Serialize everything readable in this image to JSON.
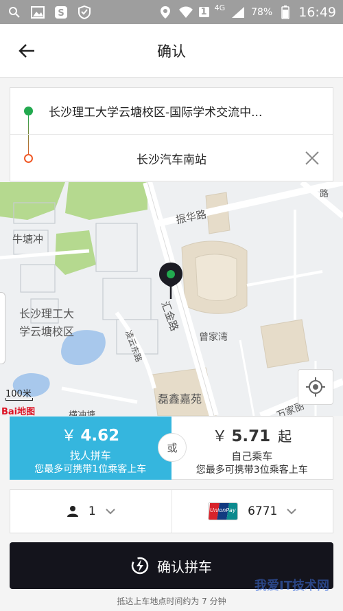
{
  "status_bar": {
    "network": "4G",
    "battery": "78%",
    "time": "16:49",
    "sim_slot": "1"
  },
  "header": {
    "title": "确认"
  },
  "route": {
    "start": "长沙理工大学云塘校区-国际学术交流中...",
    "end": "长沙汽车南站"
  },
  "map": {
    "labels": {
      "zhenhua_road": "振华路",
      "niutang": "牛塘冲",
      "campus_line1": "长沙理工大",
      "campus_line2": "学云塘校区",
      "huijin_road": "汇金路",
      "lingyun_road": "凌云东路",
      "zengjiawan": "曾家湾",
      "leixin": "磊鑫嘉苑",
      "hengchong": "横冲塘",
      "wanjia": "万家丽",
      "road_top_right": "路",
      "scale": "100米",
      "baidu_logo": "Bai地图"
    }
  },
  "options": {
    "carpool": {
      "currency": "￥",
      "price": "4.62",
      "name": "找人拼车",
      "desc": "您最多可携带1位乘客上车"
    },
    "or_label": "或",
    "solo": {
      "currency": "￥",
      "price": "5.71",
      "suffix": "起",
      "name": "自己乘车",
      "desc": "您最多可携带3位乘客上车"
    }
  },
  "selectors": {
    "passengers": "1",
    "payment_card": "6771",
    "payment_logo": "UnionPay"
  },
  "confirm_button": "确认拼车",
  "footnote": "抵达上车地点时间约为 7 分钟",
  "watermark": "我爱IT技术网",
  "colors": {
    "carpool_bg": "#35b6de",
    "confirm_bg": "#14141c",
    "start_dot": "#22a94f",
    "end_dot": "#f05a28"
  }
}
